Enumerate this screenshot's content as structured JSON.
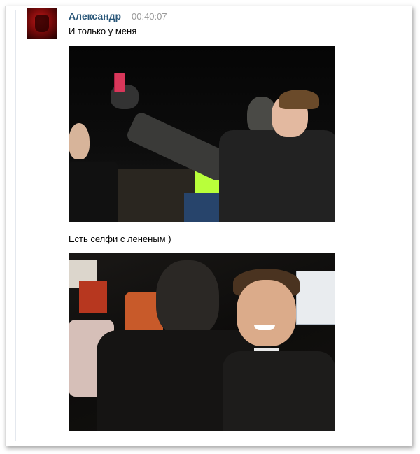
{
  "message": {
    "author": "Александр",
    "time": "00:40:07",
    "text": "И только у меня",
    "caption": "Есть селфи с лененым )"
  },
  "photos": [
    {
      "label": "photo-selfie-statue-phone"
    },
    {
      "label": "photo-selfie-with-statue"
    }
  ],
  "colors": {
    "author": "#2b587a",
    "time": "#999999",
    "text": "#000000"
  }
}
